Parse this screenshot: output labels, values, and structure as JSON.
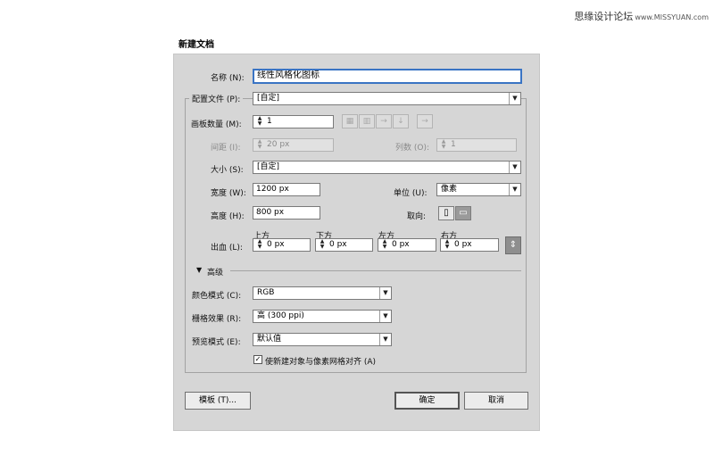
{
  "watermark": {
    "site": "思缘设计论坛",
    "url": "www.MISSYUAN.com"
  },
  "dialog": {
    "title": "新建文档",
    "name_label": "名称 (N):",
    "name_value": "线性风格化图标",
    "profile_label": "配置文件 (P):",
    "profile_value": "[自定]",
    "artboards_label": "画板数量 (M):",
    "artboards_value": "1",
    "artboard_icons": [
      "grid-by-row-icon",
      "grid-by-column-icon",
      "arrange-by-row-icon",
      "arrange-by-column-icon",
      "right-to-left-icon"
    ],
    "spacing_label": "间距 (I):",
    "spacing_value": "20 px",
    "columns_label": "列数 (O):",
    "columns_value": "1",
    "size_label": "大小 (S):",
    "size_value": "[自定]",
    "width_label": "宽度 (W):",
    "width_value": "1200 px",
    "units_label": "单位 (U):",
    "units_value": "像素",
    "height_label": "高度 (H):",
    "height_value": "800 px",
    "orientation_label": "取向:",
    "bleed_label": "出血 (L):",
    "bleed": {
      "top_label": "上方",
      "top_value": "0 px",
      "bottom_label": "下方",
      "bottom_value": "0 px",
      "left_label": "左方",
      "left_value": "0 px",
      "right_label": "右方",
      "right_value": "0 px"
    },
    "advanced_label": "高级",
    "color_mode_label": "颜色模式 (C):",
    "color_mode_value": "RGB",
    "raster_label": "栅格效果 (R):",
    "raster_value": "高 (300 ppi)",
    "preview_label": "预览模式 (E):",
    "preview_value": "默认值",
    "align_pixel_label": "使新建对象与像素网格对齐 (A)",
    "align_pixel_checked": true,
    "templates_button": "模板 (T)...",
    "ok_button": "确定",
    "cancel_button": "取消"
  },
  "colors": {
    "dialog_bg": "#d6d6d6",
    "focus_border": "#3a74c4"
  }
}
